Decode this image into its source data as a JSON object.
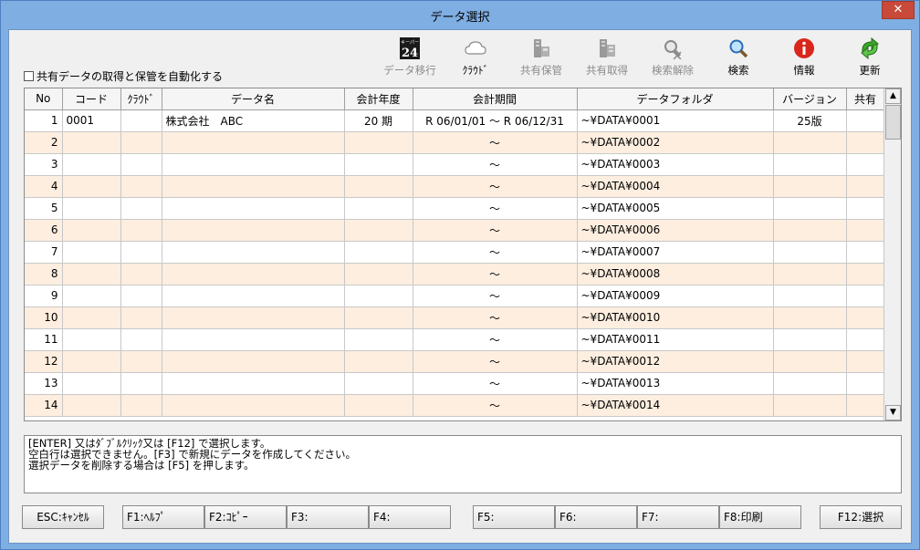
{
  "window": {
    "title": "データ選択",
    "close_glyph": "✕"
  },
  "toolbar": {
    "items": [
      {
        "label": "データ移行",
        "icon": "badge-24-icon",
        "enabled": false,
        "badge_top": "キーパー",
        "badge_num": "24"
      },
      {
        "label": "ｸﾗｳﾄﾞ",
        "icon": "cloud-icon",
        "enabled": true
      },
      {
        "label": "共有保管",
        "icon": "share-store-icon",
        "enabled": false
      },
      {
        "label": "共有取得",
        "icon": "share-get-icon",
        "enabled": false
      },
      {
        "label": "検索解除",
        "icon": "search-clear-icon",
        "enabled": false
      },
      {
        "label": "検索",
        "icon": "search-icon",
        "enabled": true
      },
      {
        "label": "情報",
        "icon": "info-icon",
        "enabled": true
      },
      {
        "label": "更新",
        "icon": "refresh-icon",
        "enabled": true
      }
    ],
    "auto_checkbox_label": "共有データの取得と保管を自動化する"
  },
  "grid": {
    "columns": [
      "No",
      "コード",
      "ｸﾗｳﾄﾞ",
      "データ名",
      "会計年度",
      "会計期間",
      "データフォルダ",
      "バージョン",
      "共有"
    ],
    "rows": [
      {
        "no": "1",
        "code": "0001",
        "cloud": "",
        "name": "株式会社　ABC",
        "year": "20 期",
        "period": "R 06/01/01 ～ R 06/12/31",
        "folder": "~¥DATA¥0001",
        "version": "25版",
        "shared": ""
      },
      {
        "no": "2",
        "code": "",
        "cloud": "",
        "name": "",
        "year": "",
        "period": "～",
        "folder": "~¥DATA¥0002",
        "version": "",
        "shared": ""
      },
      {
        "no": "3",
        "code": "",
        "cloud": "",
        "name": "",
        "year": "",
        "period": "～",
        "folder": "~¥DATA¥0003",
        "version": "",
        "shared": ""
      },
      {
        "no": "4",
        "code": "",
        "cloud": "",
        "name": "",
        "year": "",
        "period": "～",
        "folder": "~¥DATA¥0004",
        "version": "",
        "shared": ""
      },
      {
        "no": "5",
        "code": "",
        "cloud": "",
        "name": "",
        "year": "",
        "period": "～",
        "folder": "~¥DATA¥0005",
        "version": "",
        "shared": ""
      },
      {
        "no": "6",
        "code": "",
        "cloud": "",
        "name": "",
        "year": "",
        "period": "～",
        "folder": "~¥DATA¥0006",
        "version": "",
        "shared": ""
      },
      {
        "no": "7",
        "code": "",
        "cloud": "",
        "name": "",
        "year": "",
        "period": "～",
        "folder": "~¥DATA¥0007",
        "version": "",
        "shared": ""
      },
      {
        "no": "8",
        "code": "",
        "cloud": "",
        "name": "",
        "year": "",
        "period": "～",
        "folder": "~¥DATA¥0008",
        "version": "",
        "shared": ""
      },
      {
        "no": "9",
        "code": "",
        "cloud": "",
        "name": "",
        "year": "",
        "period": "～",
        "folder": "~¥DATA¥0009",
        "version": "",
        "shared": ""
      },
      {
        "no": "10",
        "code": "",
        "cloud": "",
        "name": "",
        "year": "",
        "period": "～",
        "folder": "~¥DATA¥0010",
        "version": "",
        "shared": ""
      },
      {
        "no": "11",
        "code": "",
        "cloud": "",
        "name": "",
        "year": "",
        "period": "～",
        "folder": "~¥DATA¥0011",
        "version": "",
        "shared": ""
      },
      {
        "no": "12",
        "code": "",
        "cloud": "",
        "name": "",
        "year": "",
        "period": "～",
        "folder": "~¥DATA¥0012",
        "version": "",
        "shared": ""
      },
      {
        "no": "13",
        "code": "",
        "cloud": "",
        "name": "",
        "year": "",
        "period": "～",
        "folder": "~¥DATA¥0013",
        "version": "",
        "shared": ""
      },
      {
        "no": "14",
        "code": "",
        "cloud": "",
        "name": "",
        "year": "",
        "period": "～",
        "folder": "~¥DATA¥0014",
        "version": "",
        "shared": ""
      }
    ],
    "scroll_up": "▲",
    "scroll_down": "▼"
  },
  "message": {
    "lines": [
      "[ENTER] 又はﾀﾞﾌﾞﾙｸﾘｯｸ又は [F12] で選択します。",
      "空白行は選択できません。[F3] で新規にデータを作成してください。",
      "選択データを削除する場合は [F5] を押します。"
    ]
  },
  "fkeys": [
    {
      "label": "ESC:ｷｬﾝｾﾙ"
    },
    {
      "label": "F1:ﾍﾙﾌﾟ"
    },
    {
      "label": "F2:ｺﾋﾟｰ"
    },
    {
      "label": "F3:"
    },
    {
      "label": "F4:"
    },
    {
      "label": "F5:"
    },
    {
      "label": "F6:"
    },
    {
      "label": "F7:"
    },
    {
      "label": "F8:印刷"
    },
    {
      "label": "F12:選択"
    }
  ],
  "colors": {
    "title_bar": "#7eaee2",
    "close_button": "#c94a3a",
    "row_alt": "#fdeee0",
    "window_bg": "#f0f0f0"
  }
}
